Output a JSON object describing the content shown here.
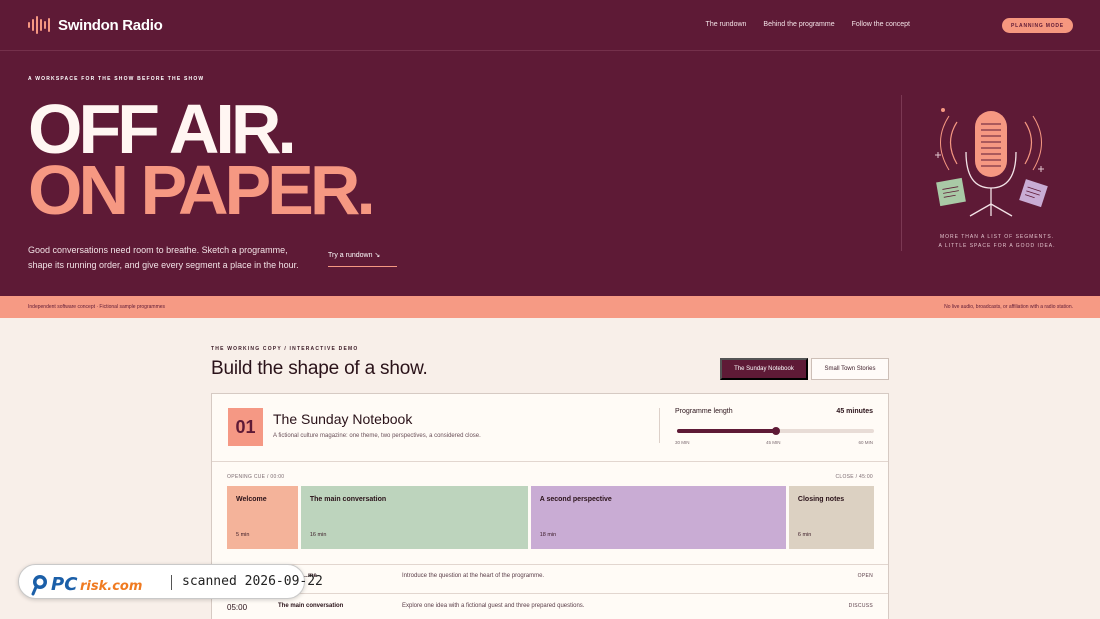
{
  "app": {
    "name": "Swindon Radio"
  },
  "nav": {
    "links": [
      "The rundown",
      "Behind the programme",
      "Follow the concept"
    ],
    "cta": "PLANNING MODE"
  },
  "hero": {
    "eyebrow": "A WORKSPACE FOR THE SHOW BEFORE THE SHOW",
    "headline_line1": "OFF AIR.",
    "headline_line2": "ON PAPER.",
    "lede": "Good conversations need room to breathe. Sketch a programme, shape its running order, and give every segment a place in the hour.",
    "try_link": "Try a rundown ↘",
    "caption_line1": "MORE THAN A LIST OF SEGMENTS.",
    "caption_line2": "A LITTLE SPACE FOR A GOOD IDEA."
  },
  "strip": {
    "left": "Independent software concept · Fictional sample programmes",
    "right": "No live audio, broadcasts, or affiliation with a radio station."
  },
  "demo": {
    "eyebrow": "THE WORKING COPY / INTERACTIVE DEMO",
    "title": "Build the shape of a show.",
    "tabs": [
      {
        "label": "The Sunday Notebook",
        "active": true
      },
      {
        "label": "Small Town Stories",
        "active": false
      }
    ]
  },
  "show": {
    "number": "01",
    "name": "The Sunday Notebook",
    "description": "A fictional culture magazine: one theme, two perspectives, a considered close.",
    "length_label": "Programme length",
    "length_value": "45 minutes",
    "length_min": 30,
    "length_max": 60,
    "length_current": 45,
    "scale": [
      "30 MIN",
      "45 MIN",
      "60 MIN"
    ],
    "opening_cue": "OPENING CUE / 00:00",
    "close_cue": "CLOSE / 45:00"
  },
  "segments": [
    {
      "title": "Welcome",
      "minutes": 5,
      "length": "5 min",
      "color": "#f4b39a"
    },
    {
      "title": "The main conversation",
      "minutes": 16,
      "length": "16 min",
      "color": "#bdd4bd"
    },
    {
      "title": "A second perspective",
      "minutes": 18,
      "length": "18 min",
      "color": "#c9acd4"
    },
    {
      "title": "Closing notes",
      "minutes": 6,
      "length": "6 min",
      "color": "#dcd1c2"
    }
  ],
  "rundown": [
    {
      "time": "",
      "title": "…me",
      "description": "Introduce the question at the heart of the programme.",
      "tag": "OPEN"
    },
    {
      "time": "05:00",
      "title": "The main conversation",
      "description": "Explore one idea with a fictional guest and three prepared questions.",
      "tag": "DISCUSS"
    }
  ],
  "watermark": {
    "brand": "PCrisk.com",
    "text": "scanned 2026-09-22"
  },
  "colors": {
    "hero_bg": "#5e1a36",
    "accent": "#f69882",
    "page_bg": "#f8efe9"
  }
}
